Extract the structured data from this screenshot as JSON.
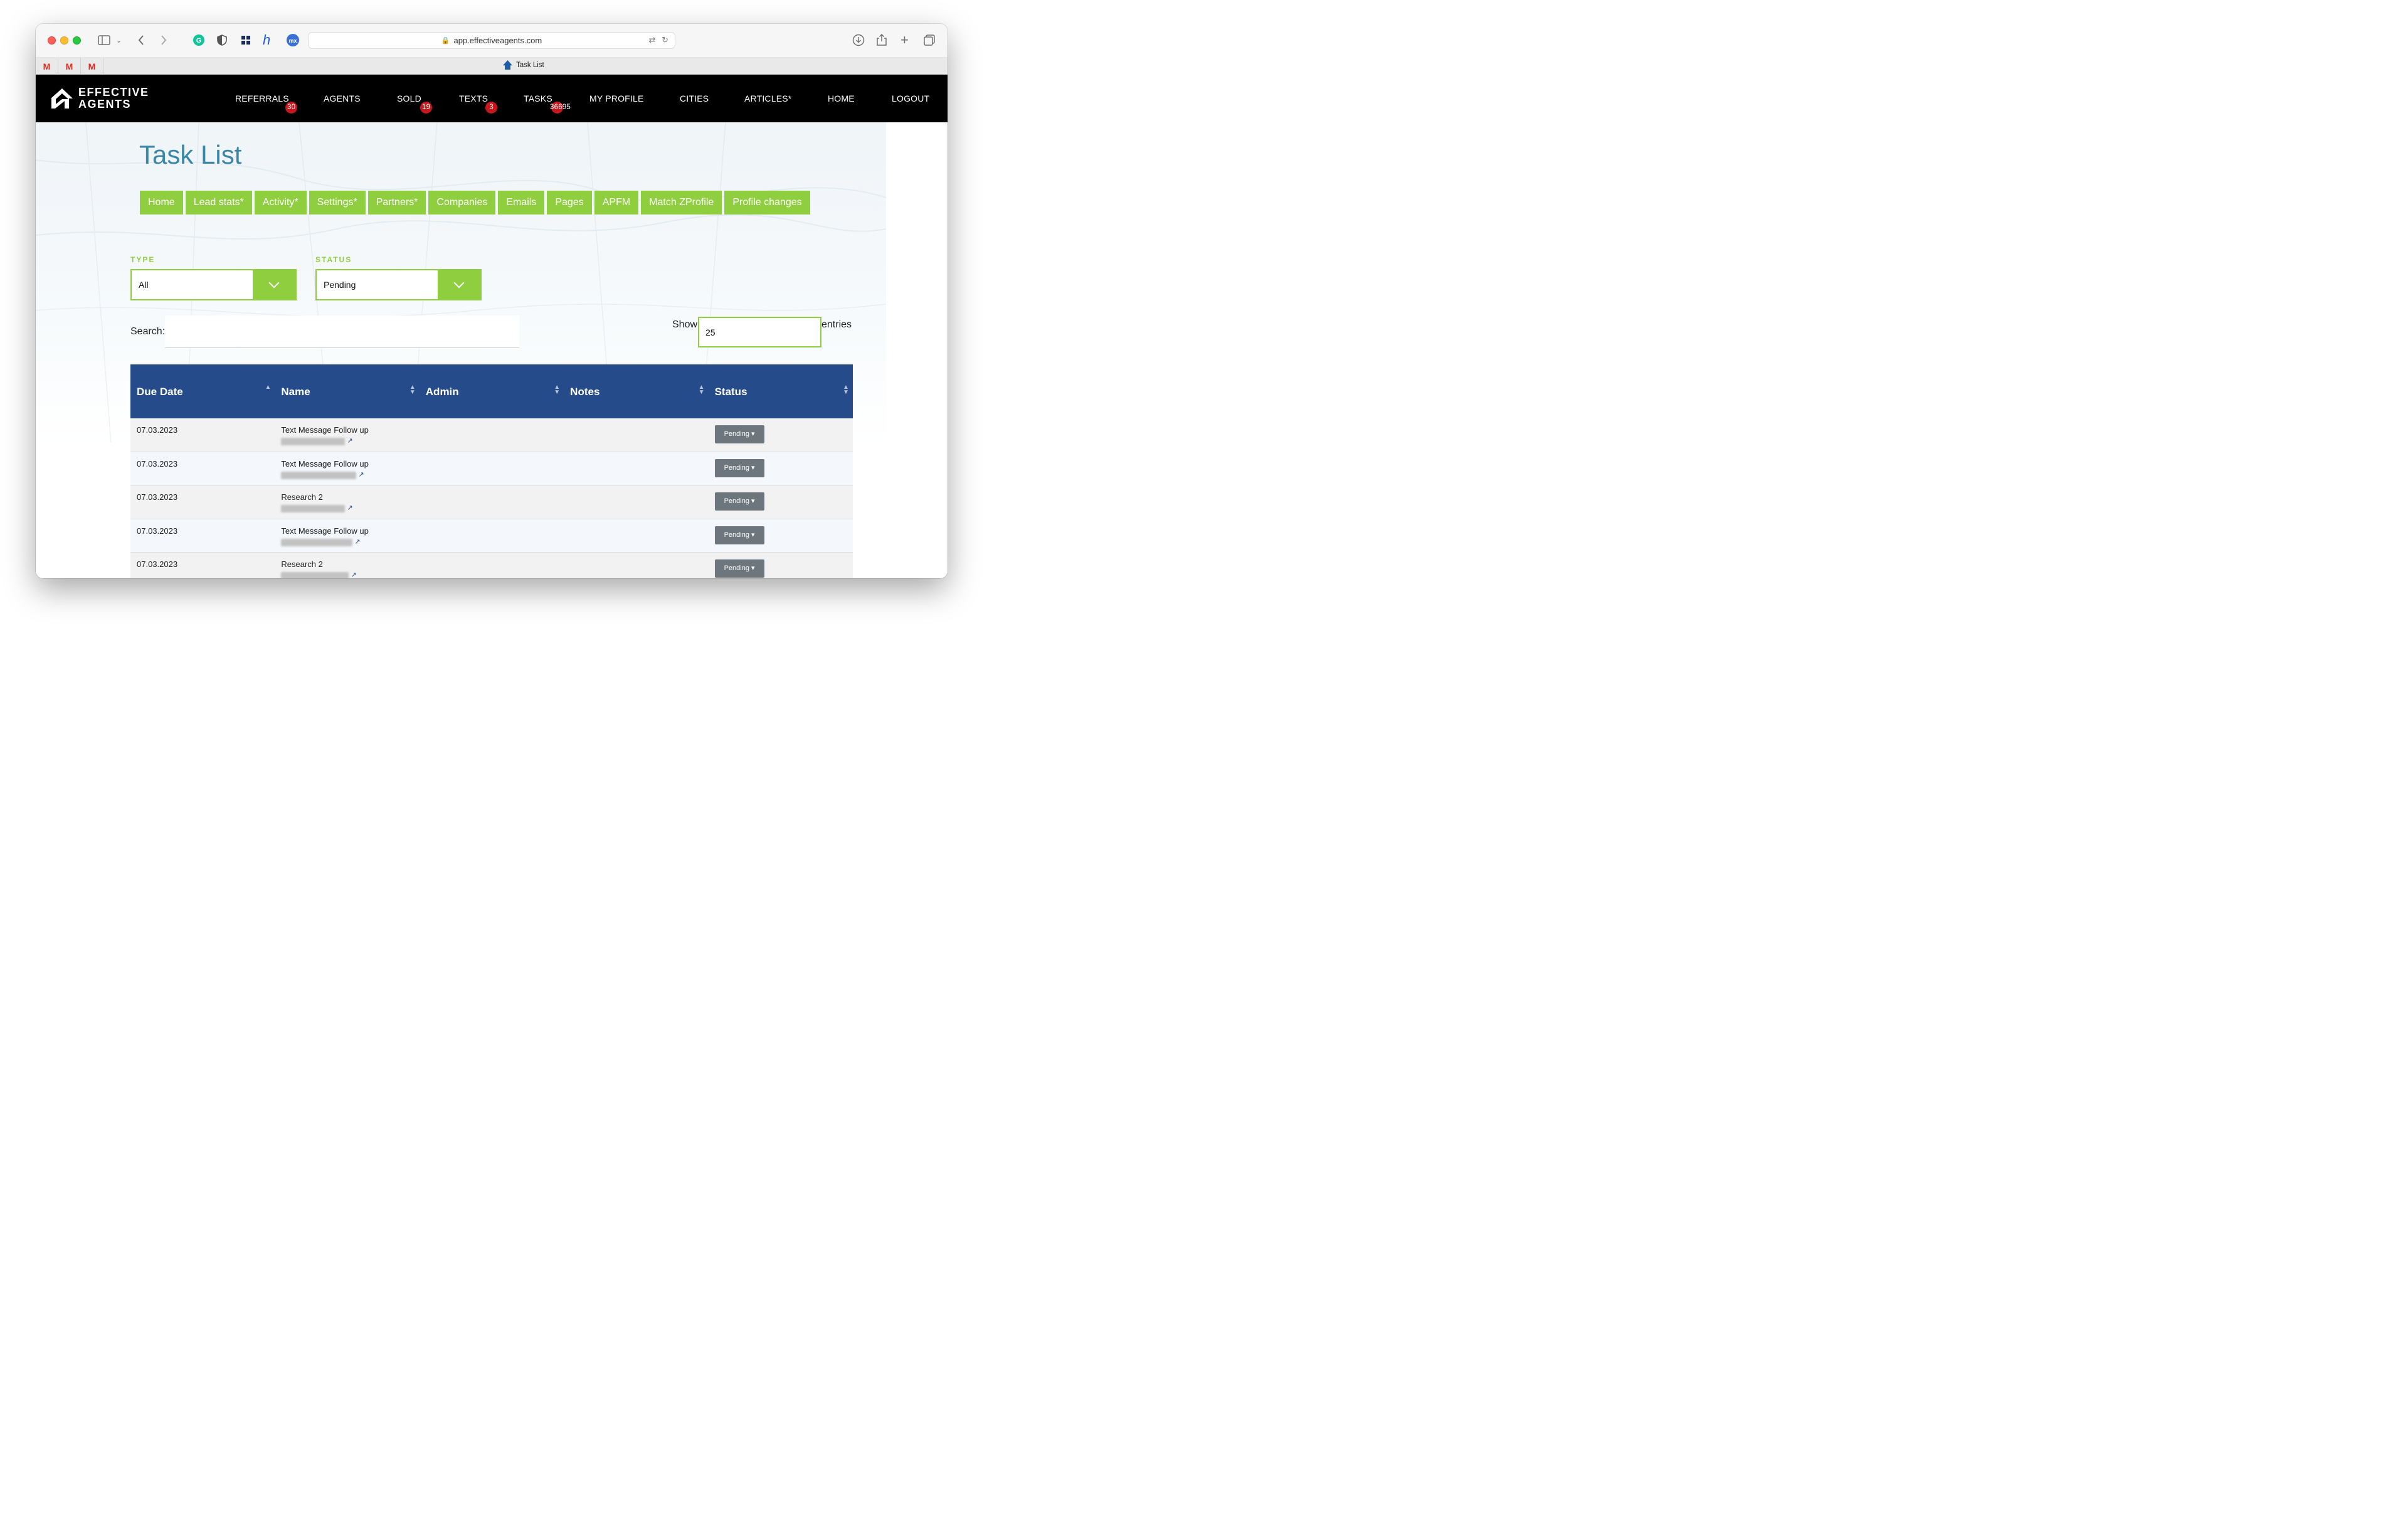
{
  "browser": {
    "url": "app.effectiveagents.com",
    "tab_title": "Task List",
    "pinned_tabs": [
      "M",
      "M",
      "M"
    ]
  },
  "site": {
    "logo_line1": "EFFECTIVE",
    "logo_line2": "AGENTS",
    "nav": [
      {
        "label": "REFERRALS",
        "badge": "30"
      },
      {
        "label": "AGENTS",
        "badge": ""
      },
      {
        "label": "SOLD",
        "badge": "19"
      },
      {
        "label": "TEXTS",
        "badge": "3"
      },
      {
        "label": "TASKS",
        "badge": "36695"
      },
      {
        "label": "MY PROFILE",
        "badge": ""
      },
      {
        "label": "CITIES",
        "badge": ""
      },
      {
        "label": "ARTICLES*",
        "badge": ""
      },
      {
        "label": "HOME",
        "badge": ""
      },
      {
        "label": "LOGOUT",
        "badge": ""
      }
    ]
  },
  "page": {
    "title": "Task List",
    "subnav": [
      "Home",
      "Lead stats*",
      "Activity*",
      "Settings*",
      "Partners*",
      "Companies",
      "Emails",
      "Pages",
      "APFM",
      "Match ZProfile",
      "Profile changes"
    ],
    "filters": {
      "type_label": "TYPE",
      "type_value": "All",
      "status_label": "STATUS",
      "status_value": "Pending"
    },
    "search_label": "Search:",
    "search_value": "",
    "show_label": "Show",
    "entries_label": "entries",
    "entries_value": "25"
  },
  "table": {
    "columns": [
      "Due Date",
      "Name",
      "Admin",
      "Notes",
      "Status"
    ],
    "rows": [
      {
        "due": "07.03.2023",
        "name": "Text Message Follow up",
        "admin": "",
        "notes": "",
        "status": "Pending"
      },
      {
        "due": "07.03.2023",
        "name": "Text Message Follow up",
        "admin": "",
        "notes": "",
        "status": "Pending"
      },
      {
        "due": "07.03.2023",
        "name": "Research 2",
        "admin": "",
        "notes": "",
        "status": "Pending"
      },
      {
        "due": "07.03.2023",
        "name": "Text Message Follow up",
        "admin": "",
        "notes": "",
        "status": "Pending"
      },
      {
        "due": "07.03.2023",
        "name": "Research 2",
        "admin": "",
        "notes": "",
        "status": "Pending"
      }
    ]
  },
  "colors": {
    "nav_bg": "#000000",
    "badge": "#c6171e",
    "accent_green": "#8fcf3f",
    "title_blue": "#3a86a6",
    "table_header": "#264b8b",
    "status_button": "#6d757d"
  }
}
